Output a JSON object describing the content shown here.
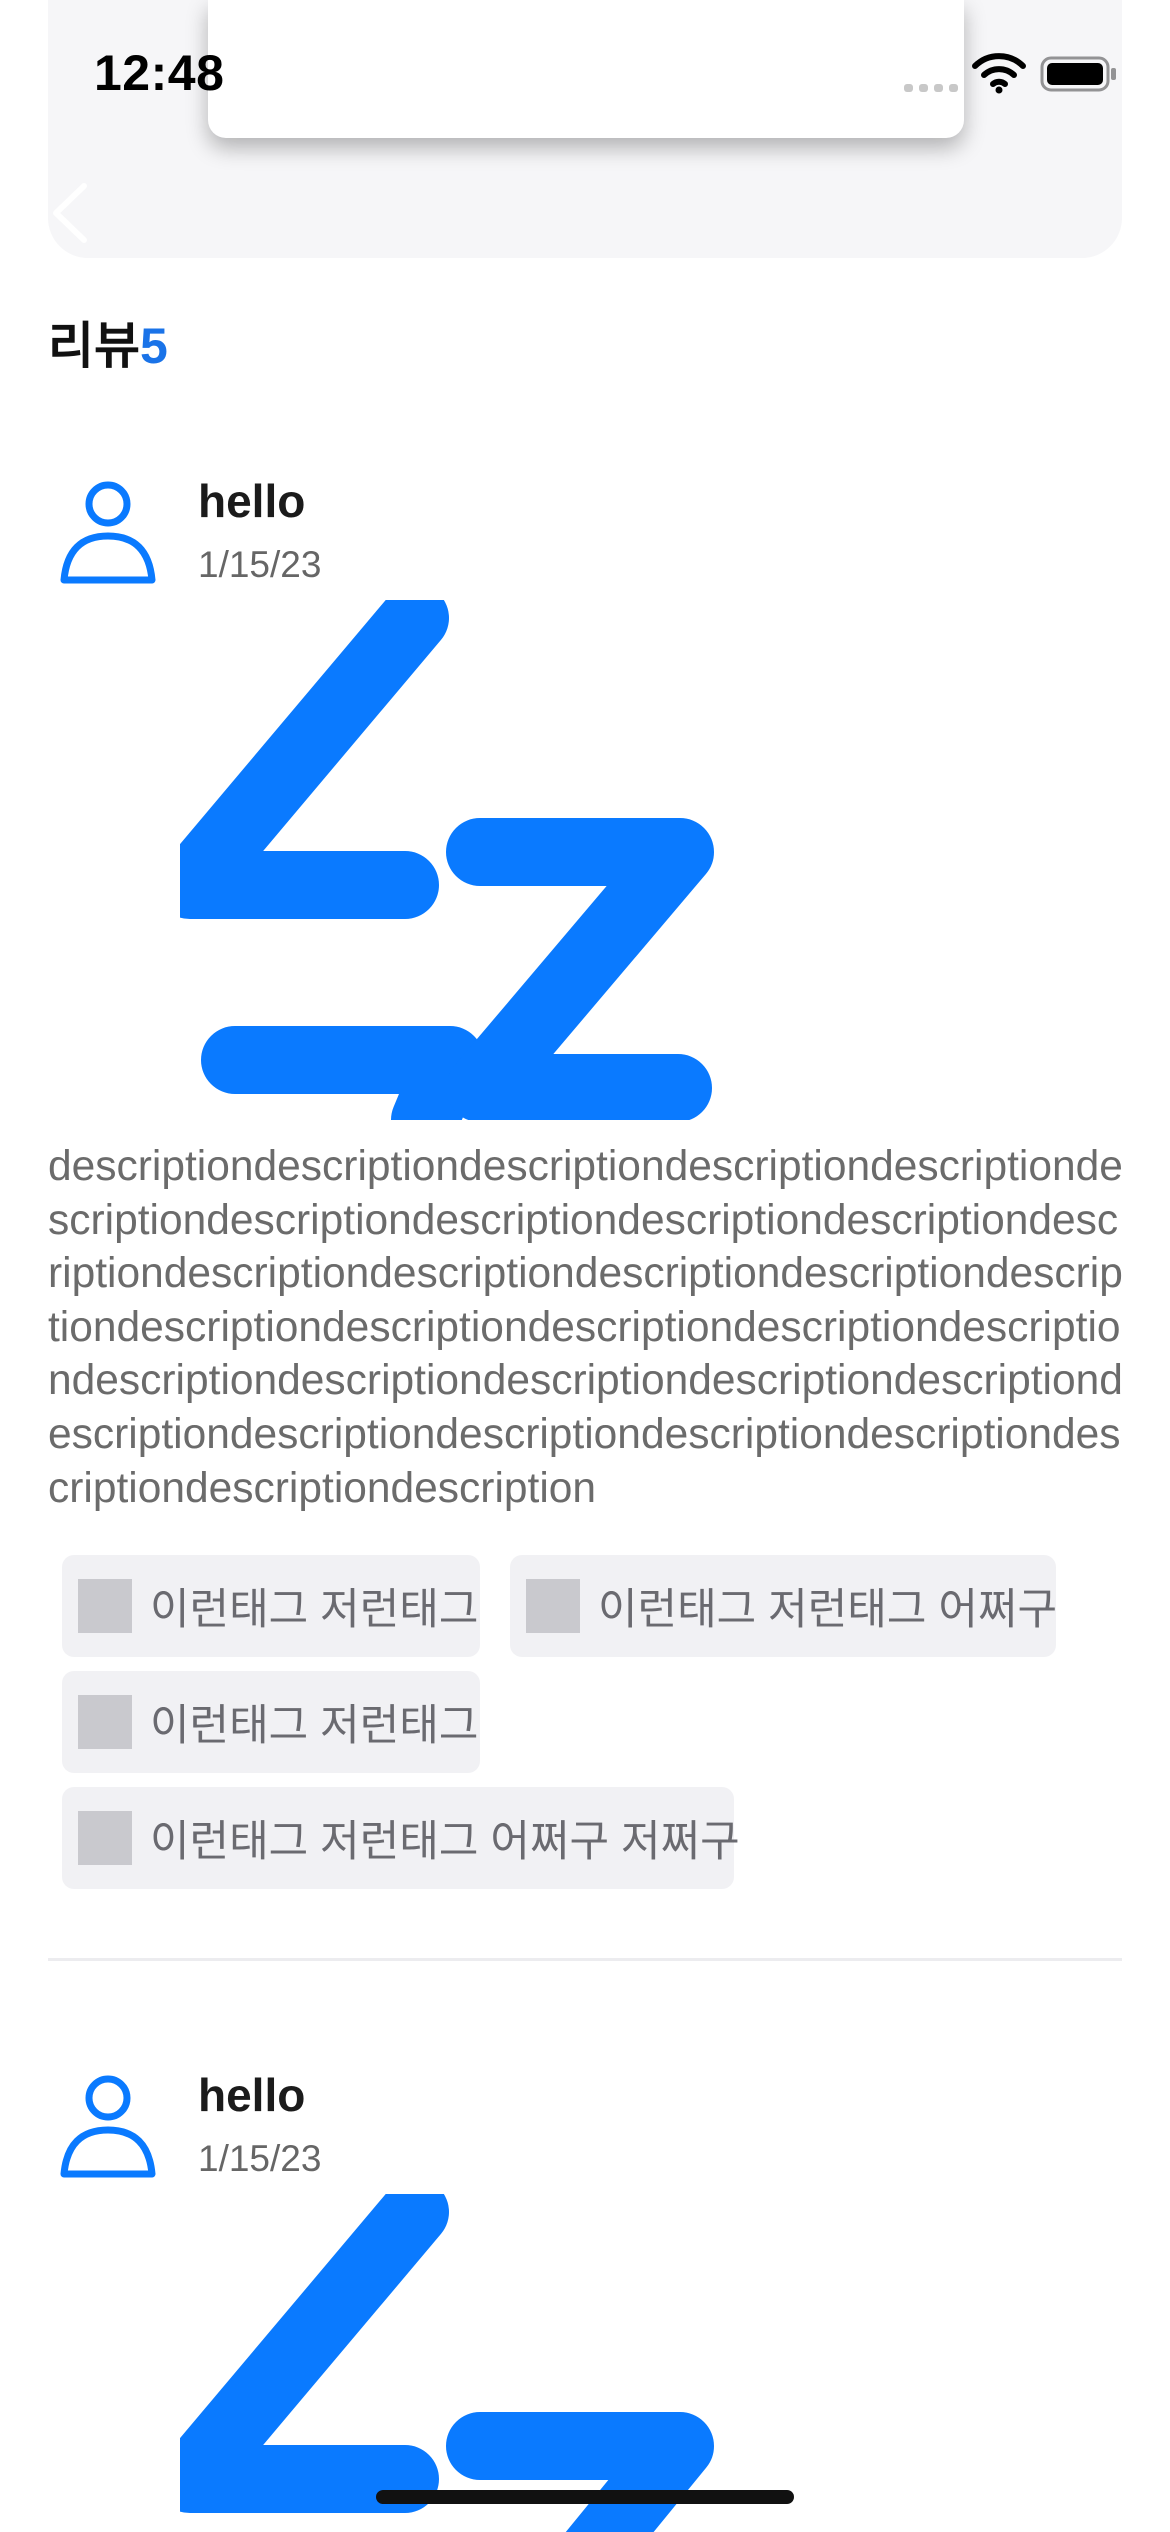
{
  "status_bar": {
    "time": "12:48"
  },
  "section": {
    "label": "리뷰",
    "count": "5"
  },
  "reviews": [
    {
      "name": "hello",
      "date": "1/15/23",
      "description": "descriptiondescriptiondescriptiondescriptiondescriptiondescriptiondescriptiondescriptiondescriptiondescriptiondescriptiondescriptiondescriptiondescriptiondescriptiondescriptiondescriptiondescriptiondescriptiondescriptiondescriptiondescriptiondescriptiondescriptiondescriptiondescriptiondescriptiondescriptiondescriptiondescriptiondescriptiondescriptiondescriptiondescription",
      "tags": [
        "이런태그 저런태그",
        "이런태그 저런태그 어쩌구",
        "이런태그 저런태그",
        "이런태그 저런태그 어쩌구 저쩌구"
      ]
    },
    {
      "name": "hello",
      "date": "1/15/23"
    }
  ],
  "colors": {
    "accent": "#0a7aff",
    "tag_bg": "#f1f1f4",
    "text_muted": "#6b6b6b"
  },
  "icons": {
    "back": "chevron-left-icon",
    "avatar": "person-icon",
    "review_image": "zz-sleep-icon",
    "wifi": "wifi-icon",
    "battery": "battery-icon",
    "signal": "cellular-signal-icon",
    "tag_thumb": "image-placeholder-icon"
  }
}
